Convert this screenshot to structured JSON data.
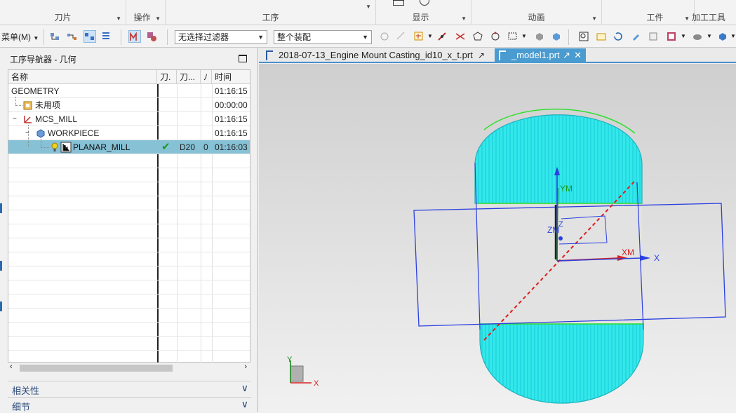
{
  "ribbon": {
    "groups": [
      "刀片",
      "操作",
      "工序",
      "显示",
      "动画",
      "工件",
      "加工工具"
    ]
  },
  "toolbar": {
    "menu_label": "菜单(M)",
    "filter_combo": "无选择过滤器",
    "assembly_combo": "整个装配"
  },
  "navigator": {
    "title": "工序导航器 - 几何",
    "columns": [
      "名称",
      "刀.",
      "刀...",
      "ﾉ",
      "时间"
    ],
    "rows": [
      {
        "name": "GEOMETRY",
        "tool": "",
        "holder": "",
        "num": "",
        "time": "01:16:15"
      },
      {
        "name": "未用项",
        "tool": "",
        "holder": "",
        "num": "",
        "time": "00:00:00"
      },
      {
        "name": "MCS_MILL",
        "tool": "",
        "holder": "",
        "num": "",
        "time": "01:16:15"
      },
      {
        "name": "WORKPIECE",
        "tool": "",
        "holder": "",
        "num": "",
        "time": "01:16:15"
      },
      {
        "name": "PLANAR_MILL",
        "tool": "✔",
        "holder": "D20",
        "num": "0",
        "time": "01:16:03"
      }
    ],
    "panels": [
      "相关性",
      "细节"
    ]
  },
  "tabs": [
    {
      "label": "2018-07-13_Engine Mount Casting_id10_x_t.prt"
    },
    {
      "label": "_model1.prt"
    }
  ],
  "viewport": {
    "axis_labels": {
      "ym": "YM",
      "xm": "XM",
      "zm": "ZM",
      "z": "Z",
      "x": "X",
      "y": "Y"
    },
    "triad_labels": {
      "x": "X",
      "y": "Y"
    }
  },
  "colors": {
    "accent": "#4a9bd0",
    "selection": "#86c1d6",
    "hatch": "#19e6e6",
    "frame": "#2b3fe0",
    "axis_red": "#d92020"
  }
}
